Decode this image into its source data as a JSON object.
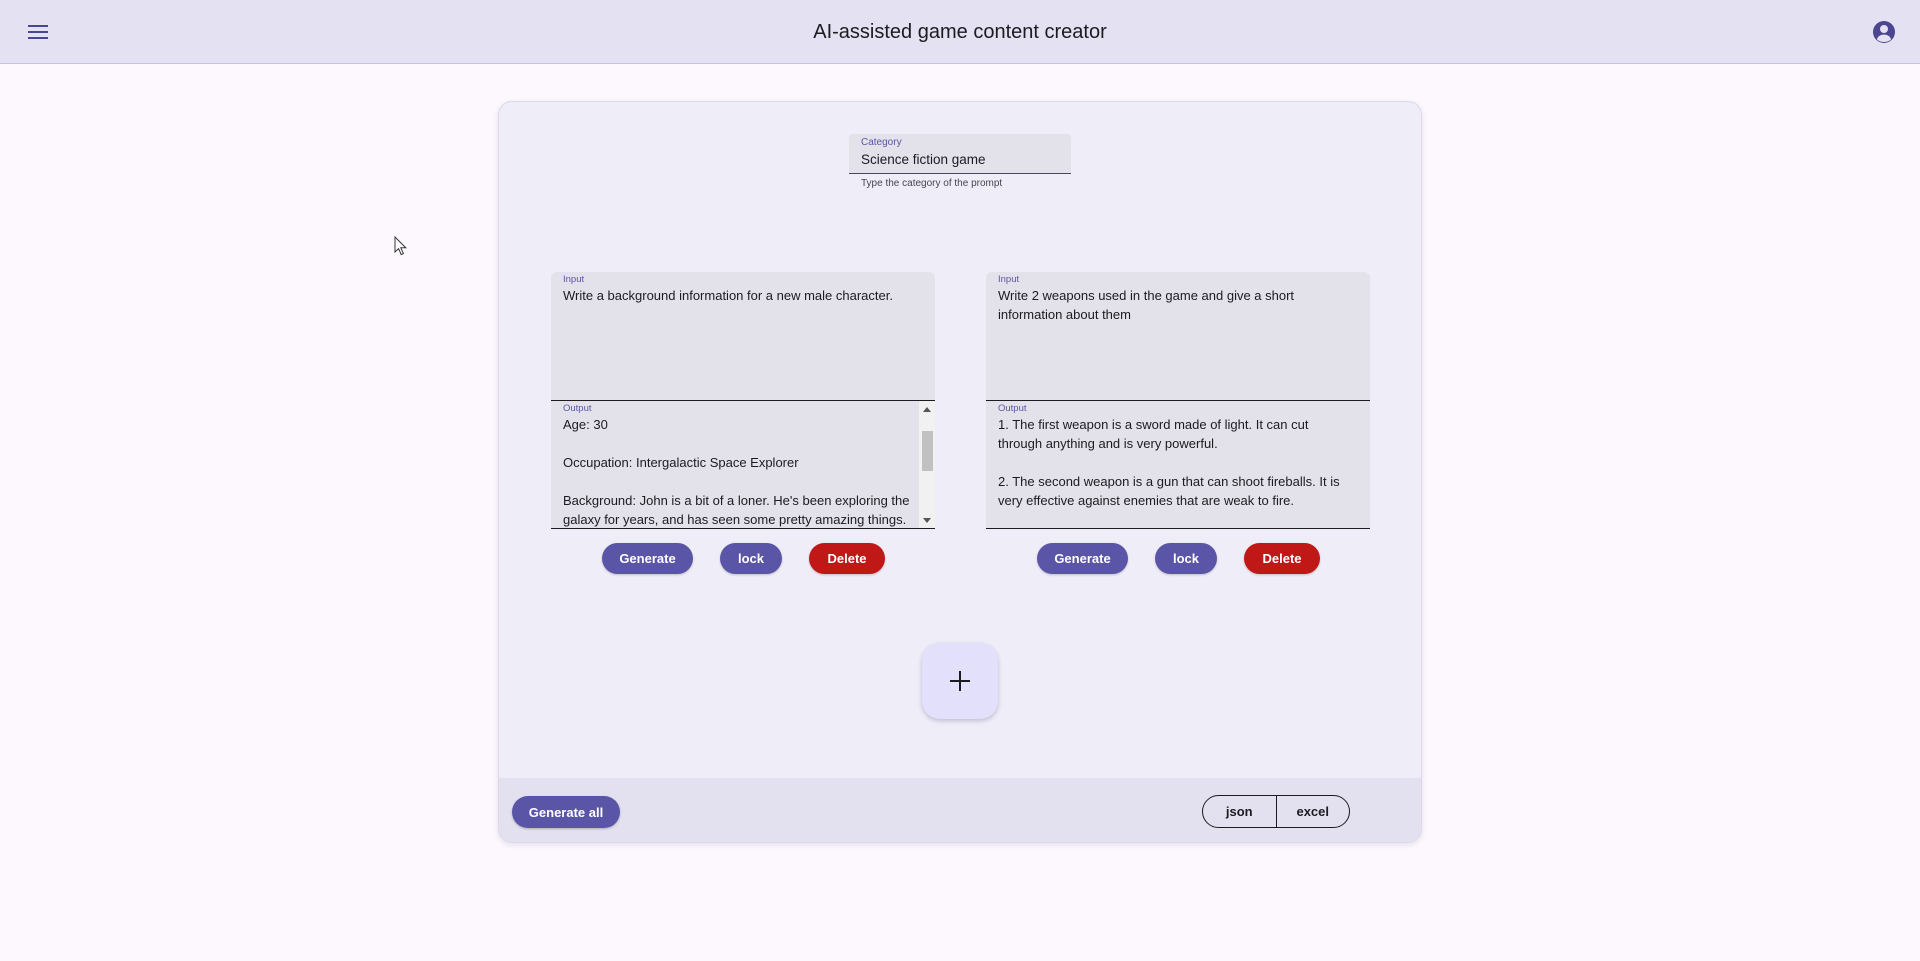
{
  "header": {
    "title": "AI-assisted game content creator",
    "menu_icon": "hamburger-menu-icon",
    "account_icon": "account-circle-icon"
  },
  "category": {
    "label": "Category",
    "value": "Science fiction game",
    "hint": "Type the category of the prompt"
  },
  "prompts": [
    {
      "input_label": "Input",
      "input_text": "Write a background information for a new male character.",
      "output_label": "Output",
      "output_text": "Age: 30\n\nOccupation: Intergalactic Space Explorer\n\nBackground: John is a bit of a loner. He's been exploring the galaxy for years, and has seen some pretty amazing things.",
      "generate_label": "Generate",
      "lock_label": "lock",
      "delete_label": "Delete"
    },
    {
      "input_label": "Input",
      "input_text": "Write 2 weapons used in the game and give a short information about them",
      "output_label": "Output",
      "output_text": "1. The first weapon is a sword made of light. It can cut through anything and is very powerful.\n\n2. The second weapon is a gun that can shoot fireballs. It is very effective against enemies that are weak to fire.",
      "generate_label": "Generate",
      "lock_label": "lock",
      "delete_label": "Delete"
    }
  ],
  "add_icon": "plus-icon",
  "footer": {
    "generate_all_label": "Generate all",
    "export_json_label": "json",
    "export_excel_label": "excel"
  },
  "colors": {
    "primary": "#5b55a8",
    "danger": "#c01717",
    "header_bg": "#e3e1f2",
    "card_bg": "#efedf7",
    "field_label": "#5b56a6"
  }
}
